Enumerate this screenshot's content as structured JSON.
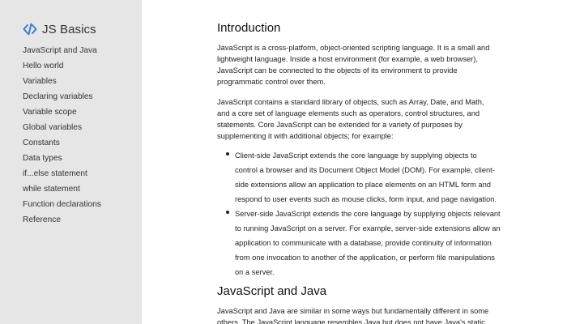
{
  "sidebar": {
    "brand_icon": "code-brackets-icon",
    "brand_title": "JS Basics",
    "accent_color": "#3c7bd8",
    "items": [
      {
        "label": "JavaScript and Java"
      },
      {
        "label": "Hello world"
      },
      {
        "label": "Variables"
      },
      {
        "label": "Declaring variables"
      },
      {
        "label": "Variable scope"
      },
      {
        "label": "Global variables"
      },
      {
        "label": "Constants"
      },
      {
        "label": "Data types"
      },
      {
        "label": "if...else statement"
      },
      {
        "label": "while statement"
      },
      {
        "label": "Function declarations"
      },
      {
        "label": "Reference"
      }
    ]
  },
  "main": {
    "intro_heading": "Introduction",
    "intro_p1": "JavaScript is a cross-platform, object-oriented scripting language. It is a small and lightweight language. Inside a host environment (for example, a web browser), JavaScript can be connected to the objects of its environment to provide programmatic control over them.",
    "intro_p2": "JavaScript contains a standard library of objects, such as Array, Date, and Math, and a core set of language elements such as operators, control structures, and statements. Core JavaScript can be extended for a variety of purposes by supplementing it with additional objects; for example:",
    "bullets": [
      "Client-side JavaScript extends the core language by supplying objects to control a browser and its Document Object Model (DOM). For example, client-side extensions allow an application to place elements on an HTML form and respond to user events such as mouse clicks, form input, and page navigation.",
      "Server-side JavaScript extends the core language by supplying objects relevant to running JavaScript on a server. For example, server-side extensions allow an application to communicate with a database, provide continuity of information from one invocation to another of the application, or perform file manipulations on a server."
    ],
    "java_heading": "JavaScript and Java",
    "java_p1": "JavaScript and Java are similar in some ways but fundamentally different in some others. The JavaScript language resembles Java but does not have Java's static typing and strong type checking."
  }
}
